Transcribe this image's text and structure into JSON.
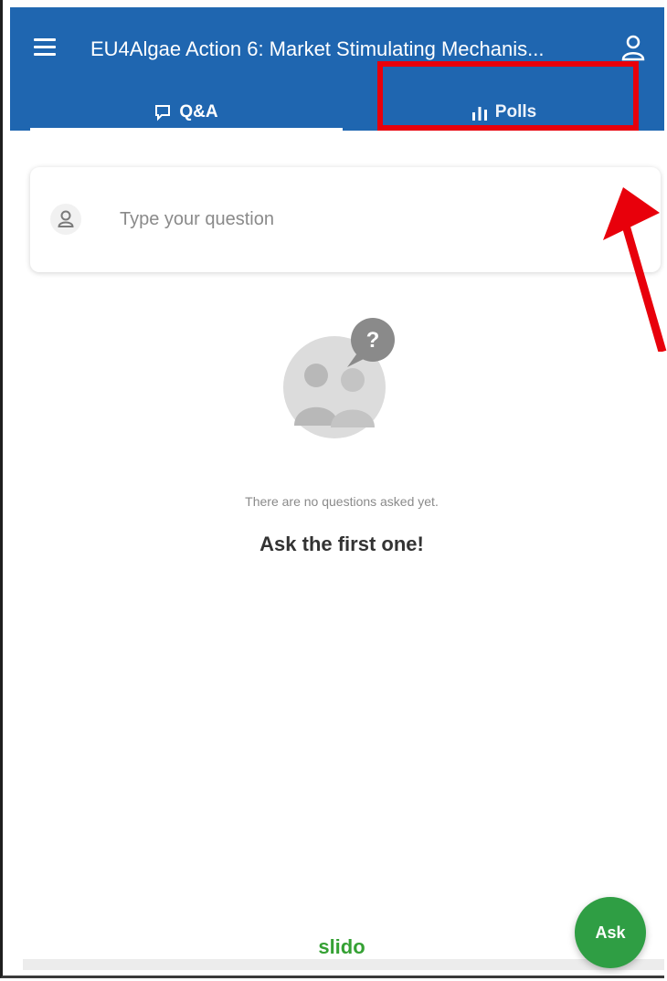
{
  "header": {
    "title": "EU4Algae Action 6: Market Stimulating Mechanis...",
    "background_color": "#1f66b0",
    "icons": {
      "menu": "menu-icon",
      "user": "user-icon"
    }
  },
  "tabs": [
    {
      "label": "Q&A",
      "icon": "chat-icon",
      "active": true
    },
    {
      "label": "Polls",
      "icon": "bar-chart-icon",
      "active": false
    }
  ],
  "question_input": {
    "placeholder": "Type your question",
    "icon": "user-icon"
  },
  "empty_state": {
    "message": "There are no questions asked yet.",
    "cta": "Ask the first one!",
    "illustration": "people-question-icon"
  },
  "fab": {
    "label": "Ask",
    "color": "#2f9e44"
  },
  "footer": {
    "brand": "slido",
    "brand_color": "#35a134"
  },
  "annotation": {
    "highlight_color": "#e8000b",
    "shape": "box-and-arrow"
  }
}
